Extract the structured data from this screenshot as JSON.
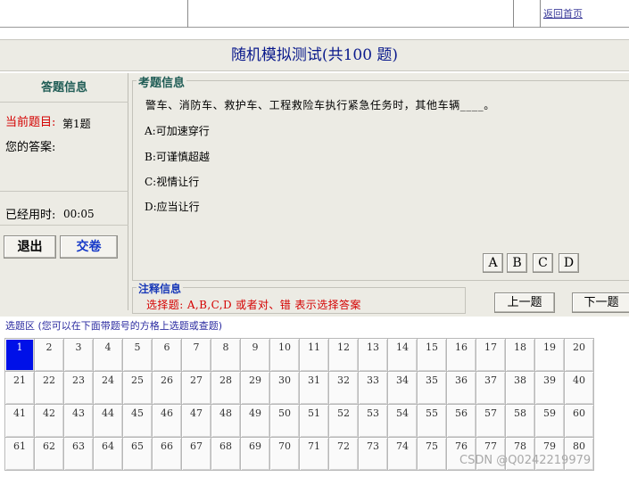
{
  "header": {
    "home_link": "返回首页"
  },
  "title": "随机模拟测试(共100 题)",
  "answer_panel": {
    "heading": "答题信息",
    "current_label": "当前题目:",
    "current_value": "第1题",
    "your_answer_label": "您的答案:",
    "elapsed_label": "已经用时:",
    "elapsed_value": "00:05",
    "exit_button": "退出",
    "submit_button": "交卷"
  },
  "question": {
    "legend": "考题信息",
    "text": "警车、消防车、救护车、工程救险车执行紧急任务时，其他车辆____。",
    "options": [
      "A:可加速穿行",
      "B:可谨慎超越",
      "C:视情让行",
      "D:应当让行"
    ],
    "choices": [
      "A",
      "B",
      "C",
      "D"
    ]
  },
  "note": {
    "legend": "注释信息",
    "text": "选择题: A,B,C,D 或者对、错 表示选择答案"
  },
  "nav": {
    "prev": "上一题",
    "next": "下一题"
  },
  "grid": {
    "label": "选题区 (您可以在下面带题号的方格上选题或查题)",
    "current": 1,
    "rows": [
      [
        "1",
        "2",
        "3",
        "4",
        "5",
        "6",
        "7",
        "8",
        "9",
        "10",
        "11",
        "12",
        "13",
        "14",
        "15",
        "16",
        "17",
        "18",
        "19",
        "20"
      ],
      [
        "21",
        "22",
        "23",
        "24",
        "25",
        "26",
        "27",
        "28",
        "29",
        "30",
        "31",
        "32",
        "33",
        "34",
        "35",
        "36",
        "37",
        "38",
        "39",
        "40"
      ],
      [
        "41",
        "42",
        "43",
        "44",
        "45",
        "46",
        "47",
        "48",
        "49",
        "50",
        "51",
        "52",
        "53",
        "54",
        "55",
        "56",
        "57",
        "58",
        "59",
        "60"
      ],
      [
        "61",
        "62",
        "63",
        "64",
        "65",
        "66",
        "67",
        "68",
        "69",
        "70",
        "71",
        "72",
        "73",
        "74",
        "75",
        "76",
        "77",
        "78",
        "79",
        "80"
      ]
    ]
  },
  "watermark": "CSDN @Q0242219979"
}
